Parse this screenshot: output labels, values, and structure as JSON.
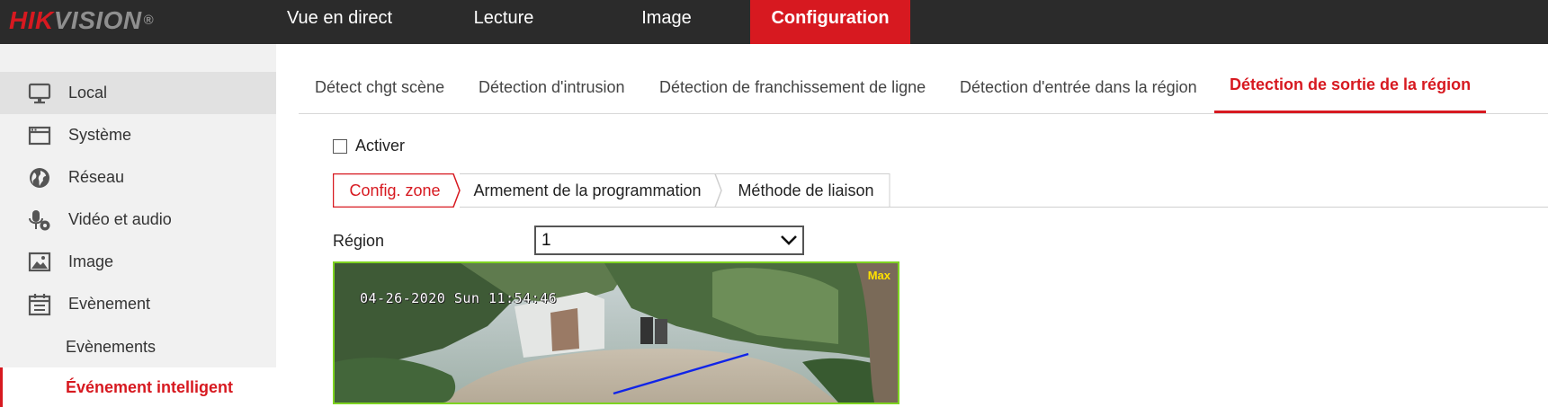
{
  "brand": {
    "part1": "HIK",
    "part2": "VISION",
    "registered": "®"
  },
  "topnav": [
    {
      "label": "Vue en direct"
    },
    {
      "label": "Lecture"
    },
    {
      "label": "Image"
    },
    {
      "label": "Configuration",
      "active": true
    }
  ],
  "sidebar": {
    "items": [
      {
        "label": "Local",
        "icon": "monitor-icon",
        "selected": true
      },
      {
        "label": "Système",
        "icon": "window-icon"
      },
      {
        "label": "Réseau",
        "icon": "globe-icon"
      },
      {
        "label": "Vidéo et audio",
        "icon": "microphone-icon"
      },
      {
        "label": "Image",
        "icon": "picture-icon"
      },
      {
        "label": "Evènement",
        "icon": "calendar-icon"
      }
    ],
    "subitems": [
      {
        "label": "Evènements"
      },
      {
        "label": "Événement intelligent",
        "active": true
      }
    ]
  },
  "tabs": [
    {
      "label": "Détect chgt scène"
    },
    {
      "label": "Détection d'intrusion"
    },
    {
      "label": "Détection de franchissement de ligne"
    },
    {
      "label": "Détection d'entrée dans la région"
    },
    {
      "label": "Détection de sortie de la région",
      "active": true
    }
  ],
  "enable": {
    "label": "Activer",
    "checked": false
  },
  "subtabs": [
    {
      "label": "Config. zone",
      "active": true
    },
    {
      "label": "Armement de la programmation"
    },
    {
      "label": "Méthode de liaison"
    }
  ],
  "region": {
    "label": "Région",
    "value": "1"
  },
  "video": {
    "osd_timestamp": "04-26-2020 Sun 11:54:46",
    "max_label": "Max"
  },
  "colors": {
    "accent": "#d71920",
    "topbar": "#2b2b2b",
    "sidebar": "#f1f1f1",
    "video_border": "#7ed321",
    "line": "#1024e8"
  }
}
